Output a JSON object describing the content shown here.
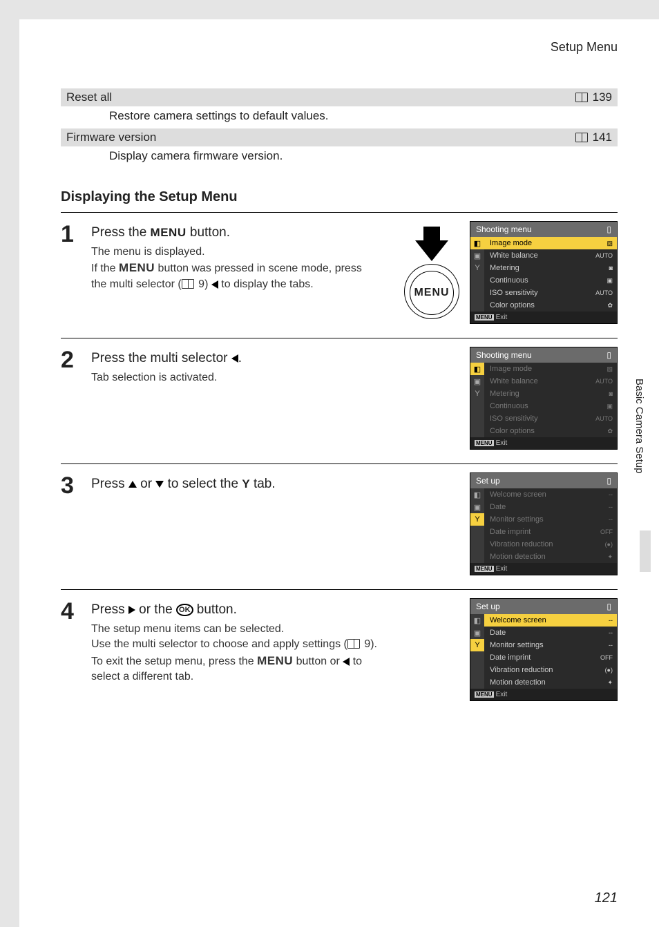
{
  "header": {
    "title": "Setup Menu"
  },
  "rows": [
    {
      "title": "Reset all",
      "page": "139",
      "desc": "Restore camera settings to default values."
    },
    {
      "title": "Firmware version",
      "page": "141",
      "desc": "Display camera firmware version."
    }
  ],
  "section_heading": "Displaying the Setup Menu",
  "steps": {
    "s1": {
      "num": "1",
      "title_a": "Press the ",
      "title_menu": "MENU",
      "title_b": " button.",
      "p1": "The menu is displayed.",
      "p2a": "If the ",
      "p2menu": "MENU",
      "p2b": " button was pressed in scene mode, press the multi selector (",
      "p2ref": "9",
      "p2c": ") ",
      "p2d": " to display the tabs.",
      "menu_btn_label": "MENU"
    },
    "s2": {
      "num": "2",
      "title_a": "Press the multi selector ",
      "title_b": ".",
      "p1": "Tab selection is activated."
    },
    "s3": {
      "num": "3",
      "title_a": "Press ",
      "title_b": " or ",
      "title_c": " to select the ",
      "title_d": " tab."
    },
    "s4": {
      "num": "4",
      "title_a": "Press ",
      "title_b": " or the ",
      "title_ok": "OK",
      "title_c": " button.",
      "p1": "The setup menu items can be selected.",
      "p2a": "Use the multi selector to choose and apply settings (",
      "p2ref": "9",
      "p2b": ").",
      "p3a": "To exit the setup menu, press the ",
      "p3menu": "MENU",
      "p3b": " button or ",
      "p3c": " to select a different tab."
    }
  },
  "cam1": {
    "title": "Shooting menu",
    "items": [
      {
        "l": "Image mode",
        "v": "▧"
      },
      {
        "l": "White balance",
        "v": "AUTO"
      },
      {
        "l": "Metering",
        "v": "◙"
      },
      {
        "l": "Continuous",
        "v": "▣"
      },
      {
        "l": "ISO sensitivity",
        "v": "AUTO"
      },
      {
        "l": "Color options",
        "v": "✿"
      }
    ],
    "exit": "Exit"
  },
  "cam2": {
    "title": "Shooting menu",
    "items": [
      {
        "l": "Image mode",
        "v": "▧"
      },
      {
        "l": "White balance",
        "v": "AUTO"
      },
      {
        "l": "Metering",
        "v": "◙"
      },
      {
        "l": "Continuous",
        "v": "▣"
      },
      {
        "l": "ISO sensitivity",
        "v": "AUTO"
      },
      {
        "l": "Color options",
        "v": "✿"
      }
    ],
    "exit": "Exit"
  },
  "cam3": {
    "title": "Set up",
    "items": [
      {
        "l": "Welcome screen",
        "v": "--"
      },
      {
        "l": "Date",
        "v": "--"
      },
      {
        "l": "Monitor settings",
        "v": "--"
      },
      {
        "l": "Date imprint",
        "v": "OFF"
      },
      {
        "l": "Vibration reduction",
        "v": "(●)"
      },
      {
        "l": "Motion detection",
        "v": "✦"
      }
    ],
    "exit": "Exit"
  },
  "cam4": {
    "title": "Set up",
    "items": [
      {
        "l": "Welcome screen",
        "v": "--"
      },
      {
        "l": "Date",
        "v": "--"
      },
      {
        "l": "Monitor settings",
        "v": "--"
      },
      {
        "l": "Date imprint",
        "v": "OFF"
      },
      {
        "l": "Vibration reduction",
        "v": "(●)"
      },
      {
        "l": "Motion detection",
        "v": "✦"
      }
    ],
    "exit": "Exit"
  },
  "side_label": "Basic Camera Setup",
  "page_number": "121"
}
